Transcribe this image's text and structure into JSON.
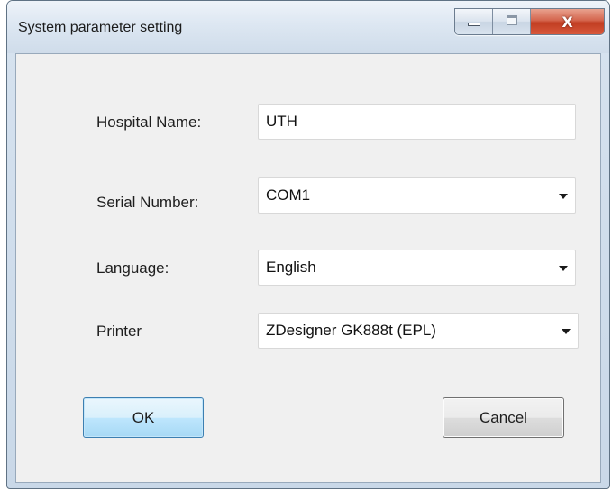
{
  "window": {
    "title": "System parameter setting"
  },
  "controls": {
    "minimize_icon": "minimize-icon",
    "maximize_icon": "maximize-icon",
    "close_icon": "close-icon",
    "close_glyph": "X"
  },
  "form": {
    "hospital_name": {
      "label": "Hospital Name:",
      "value": "UTH"
    },
    "serial_number": {
      "label": "Serial Number:",
      "value": "COM1"
    },
    "language": {
      "label": "Language:",
      "value": "English"
    },
    "printer": {
      "label": "Printer",
      "value": "ZDesigner GK888t (EPL)"
    }
  },
  "buttons": {
    "ok": "OK",
    "cancel": "Cancel"
  },
  "colors": {
    "close_button": "#c13d22",
    "ok_border": "#3c7fb1",
    "client_background": "#f0f0f0"
  }
}
